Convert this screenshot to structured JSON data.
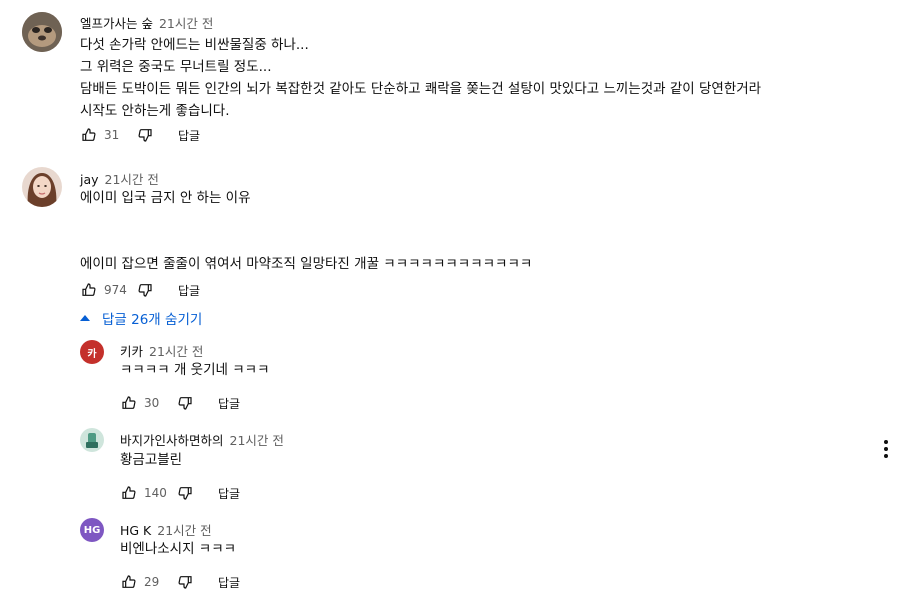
{
  "comments": [
    {
      "author": "엘프가사는 숲",
      "time": "21시간 전",
      "text": "다섯 손가락 안에드는 비싼물질중 하나...\n그 위력은 중국도 무너트릴 정도...\n담배든 도박이든 뭐든 인간의 뇌가 복잡한것 같아도 단순하고 쾌락을 쫒는건 설탕이 맛있다고 느끼는것과 같이 당연한거라\n시작도 안하는게 좋습니다.",
      "likes": "31",
      "reply_label": "답글"
    },
    {
      "author": "jay",
      "time": "21시간 전",
      "text": "에이미 입국 금지 안 하는 이유\n\n\n에이미 잡으면 줄줄이 엮여서 마약조직 일망타진 개꿀 ㅋㅋㅋㅋㅋㅋㅋㅋㅋㅋㅋㅋ",
      "likes": "974",
      "reply_label": "답글"
    }
  ],
  "replies_toggle": "답글 26개 숨기기",
  "replies": [
    {
      "avatar_letter": "카",
      "avatar_color": "#c4302b",
      "author": "키카",
      "time": "21시간 전",
      "text": "ㅋㅋㅋㅋ 개 웃기네 ㅋㅋㅋ",
      "likes": "30",
      "reply_label": "답글"
    },
    {
      "avatar_letter": "",
      "avatar_color": "#7fb7a3",
      "author": "바지가인사하면하의",
      "time": "21시간 전",
      "text": "황금고블린",
      "likes": "140",
      "reply_label": "답글"
    },
    {
      "avatar_letter": "HG",
      "avatar_color": "#7e57c2",
      "author": "HG K",
      "time": "21시간 전",
      "text": "비엔나소시지 ㅋㅋㅋ",
      "likes": "29",
      "reply_label": "답글"
    }
  ],
  "colors": {
    "link": "#065fd4",
    "secondary_text": "#606060"
  },
  "icons": {
    "like": "thumbs-up-icon",
    "dislike": "thumbs-down-icon",
    "more": "more-vert-icon",
    "toggle": "triangle-up-icon"
  }
}
